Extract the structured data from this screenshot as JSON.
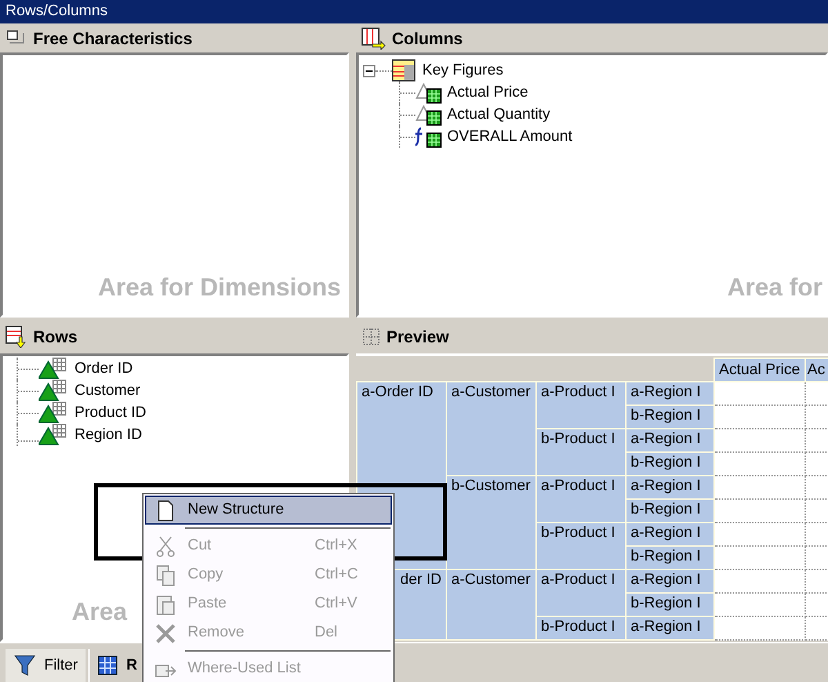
{
  "window": {
    "title": "Rows/Columns"
  },
  "free_characteristics": {
    "title": "Free Characteristics",
    "hint": "Area for Dimensions"
  },
  "columns": {
    "title": "Columns",
    "hint": "Area for",
    "tree": [
      {
        "label": "Key Figures",
        "expanded": true,
        "children": [
          {
            "label": "Actual Price",
            "kind": "key_figure"
          },
          {
            "label": "Actual Quantity",
            "kind": "key_figure"
          },
          {
            "label": "OVERALL Amount",
            "kind": "formula"
          }
        ]
      }
    ]
  },
  "rows": {
    "title": "Rows",
    "hint": "Area",
    "items": [
      "Order ID",
      "Customer",
      "Product ID",
      "Region ID"
    ]
  },
  "preview": {
    "title": "Preview",
    "columns": [
      "Actual Price",
      "Ac"
    ],
    "tree": [
      {
        "label": "a-Order ID",
        "children": [
          {
            "label": "a-Customer",
            "children": [
              {
                "label": "a-Product I",
                "children": [
                  "a-Region I",
                  "b-Region I"
                ]
              },
              {
                "label": "b-Product I",
                "children": [
                  "a-Region I",
                  "b-Region I"
                ]
              }
            ]
          },
          {
            "label": "b-Customer",
            "children": [
              {
                "label": "a-Product I",
                "children": [
                  "a-Region I",
                  "b-Region I"
                ]
              },
              {
                "label": "b-Product I",
                "children": [
                  "a-Region I",
                  "b-Region I"
                ]
              }
            ]
          }
        ]
      },
      {
        "label": "der ID",
        "children": [
          {
            "label": "a-Customer",
            "children": [
              {
                "label": "a-Product I",
                "children": [
                  "a-Region I",
                  "b-Region I"
                ]
              },
              {
                "label": "b-Product I",
                "children": [
                  "a-Region I"
                ]
              }
            ]
          }
        ]
      }
    ]
  },
  "tabs": [
    {
      "label": "Filter",
      "kind": "filter",
      "selected": false
    },
    {
      "label": "R",
      "kind": "rows",
      "selected": true
    }
  ],
  "context_menu": [
    {
      "kind": "item",
      "label": "New Structure",
      "selected": true,
      "disabled": false
    },
    {
      "kind": "separator"
    },
    {
      "kind": "item",
      "label": "Cut",
      "shortcut": "Ctrl+X",
      "selected": false,
      "disabled": true
    },
    {
      "kind": "item",
      "label": "Copy",
      "shortcut": "Ctrl+C",
      "selected": false,
      "disabled": true
    },
    {
      "kind": "item",
      "label": "Paste",
      "shortcut": "Ctrl+V",
      "selected": false,
      "disabled": true
    },
    {
      "kind": "item",
      "label": "Remove",
      "shortcut": "Del",
      "selected": false,
      "disabled": true
    },
    {
      "kind": "separator"
    },
    {
      "kind": "item",
      "label": "Where-Used List",
      "selected": false,
      "disabled": true
    }
  ]
}
